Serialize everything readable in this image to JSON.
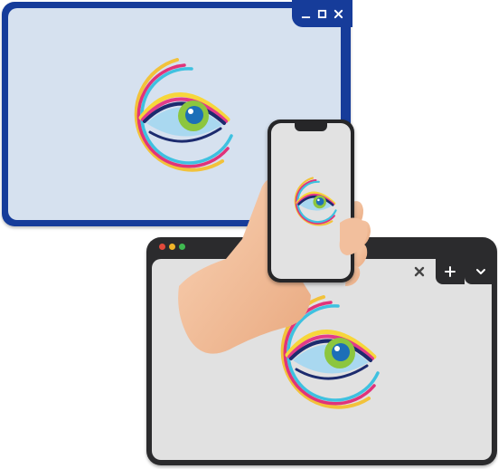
{
  "window_primary": {
    "controls": {
      "minimize": "minimize-icon",
      "maximize": "maximize-icon",
      "close": "close-icon"
    },
    "frame_color": "#163c9a",
    "background_color": "#d6e1ef"
  },
  "window_secondary": {
    "traffic_lights": [
      "#e24a3b",
      "#f0b429",
      "#3fb950"
    ],
    "tabs": {
      "close": "close-icon",
      "new_tab": "plus-icon",
      "menu": "chevron-down-icon"
    },
    "frame_color": "#2b2b2d",
    "background_color": "#e1e1e1"
  },
  "phone": {
    "frame_color": "#262628",
    "screen_color": "#e2e2e2"
  },
  "logo": {
    "name": "eye-logo",
    "colors": {
      "ring_outer": "#f2c23a",
      "ring_mid": "#e0337a",
      "ring_inner": "#3ec1e0",
      "lid_yellow": "#f7d63a",
      "lid_pink": "#e23b8a",
      "lid_dark": "#1c2b6e",
      "eye_white": "#a9d8f0",
      "iris": "#8cc63f",
      "pupil": "#1c6fb8"
    }
  }
}
